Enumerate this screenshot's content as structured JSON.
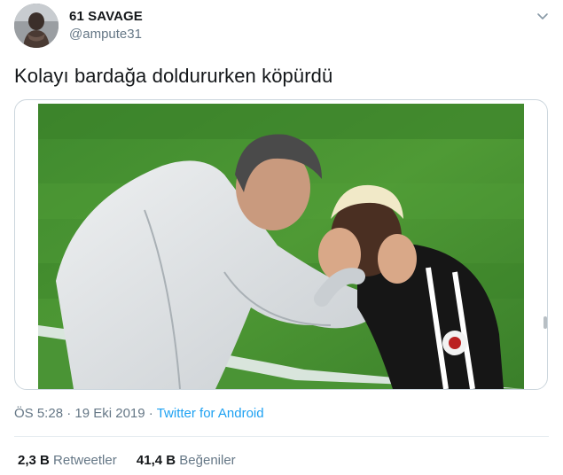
{
  "user": {
    "display_name": "61 SAVAGE",
    "handle": "@ampute31"
  },
  "tweet": {
    "text": "Kolayı bardağa doldururken köpürdü"
  },
  "meta": {
    "time": "ÖS 5:28",
    "separator": "·",
    "date": "19 Eki 2019",
    "source": "Twitter for Android"
  },
  "stats": {
    "retweets_count": "2,3 B",
    "retweets_label": "Retweetler",
    "likes_count": "41,4 B",
    "likes_label": "Beğeniler"
  },
  "colors": {
    "link": "#1da1f2",
    "muted": "#657786",
    "text": "#14171a",
    "border": "#ccd6dd"
  },
  "icons": {
    "menu": "chevron-down-icon"
  }
}
